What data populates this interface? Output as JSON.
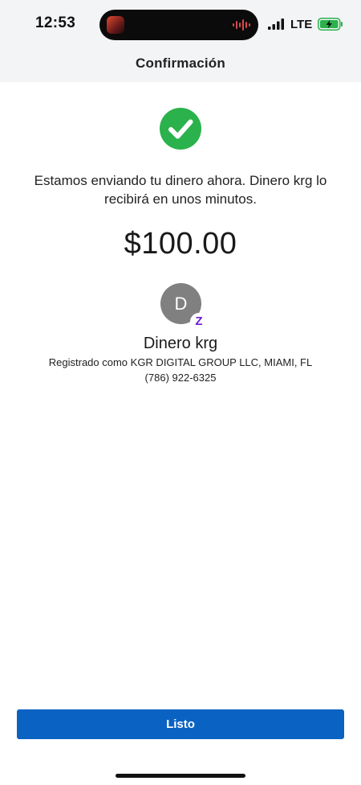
{
  "status_bar": {
    "time": "12:53",
    "network": "LTE"
  },
  "nav": {
    "title": "Confirmación"
  },
  "confirmation": {
    "message": "Estamos enviando tu dinero ahora. Dinero krg lo recibirá en unos minutos.",
    "amount": "$100.00"
  },
  "recipient": {
    "initial": "D",
    "badge": "Z",
    "name": "Dinero krg",
    "registered": "Registrado como KGR DIGITAL GROUP LLC, MIAMI, FL",
    "phone": "(786) 922-6325"
  },
  "actions": {
    "done_label": "Listo"
  },
  "colors": {
    "success_green": "#2bb24c",
    "button_blue": "#0a62c2",
    "zelle_purple": "#6d1ed4",
    "header_bg": "#f3f4f6",
    "avatar_gray": "#808080"
  },
  "icons": [
    "check-circle-icon",
    "cellular-signal-icon",
    "battery-charging-icon",
    "audio-wave-icon",
    "zelle-badge-icon"
  ]
}
